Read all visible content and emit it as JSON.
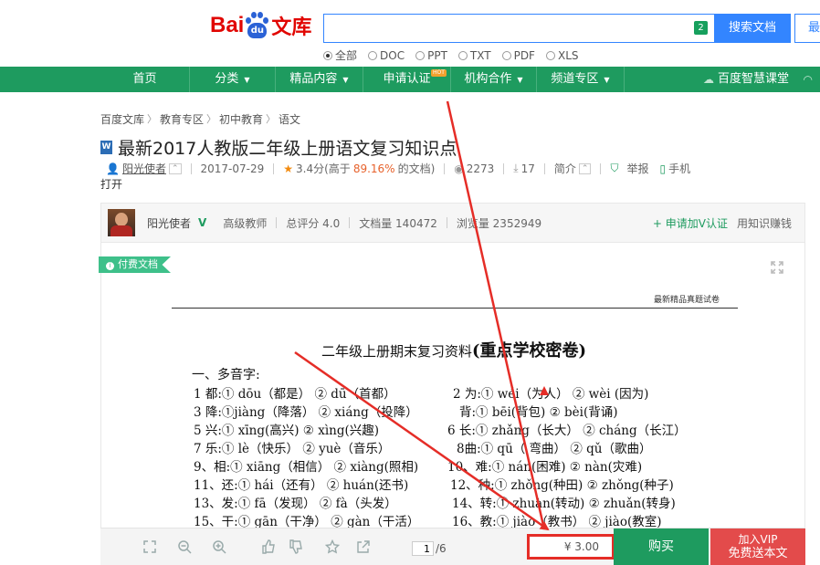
{
  "header": {
    "logo_left": "Bai",
    "logo_paw": "du",
    "logo_right": "文库",
    "search_value": "",
    "search_badge": "2",
    "search_button": "搜索文档",
    "search_button2": "最",
    "filetypes": [
      "全部",
      "DOC",
      "PPT",
      "TXT",
      "PDF",
      "XLS"
    ]
  },
  "nav": {
    "items": [
      "首页",
      "分类",
      "精品内容",
      "申请认证",
      "机构合作",
      "频道专区"
    ],
    "hot": "HOT",
    "right": "百度智慧课堂"
  },
  "breadcrumb": [
    "百度文库",
    "教育专区",
    "初中教育",
    "语文"
  ],
  "doc": {
    "title": "最新2017人教版二年级上册语文复习知识点",
    "author": "阳光使者",
    "date": "2017-07-29",
    "rating": "3.4分(高于",
    "rating_pct": "89.16%",
    "rating_tail": "的文档)",
    "views": "2273",
    "downloads": "17",
    "summary": "简介",
    "report": "举报",
    "mobile": "手机",
    "open": "打开"
  },
  "author_bar": {
    "name": "阳光使者",
    "v": "V",
    "level": "高级教师",
    "score": "总评分 4.0",
    "docs": "文档量 140472",
    "browse": "浏览量 2352949",
    "apply": "+ 申请加V认证",
    "earn": "用知识赚钱"
  },
  "paid_tag": "付费文档",
  "paper": {
    "header": "最新精品真题试卷",
    "title": "二年级上册期末复习资料",
    "title_bold": "(重点学校密卷)",
    "section": "一、多音字:",
    "lines": [
      {
        "a": "1 都:①  dōu（都是） ②  dū（首都）",
        "b": "2 为:①  wéi（为人）    ②  wèi (因为)"
      },
      {
        "a": "3 降:①jiàng（降落）   ②  xiáng（投降）",
        "b": "背:①  bēi(背包)       ②  bèi(背诵)"
      },
      {
        "a": "5 兴:①  xīng(高兴)     ②  xìng(兴趣)",
        "b": "6 长:①  zhǎng（长大）  ②  cháng（长江）"
      },
      {
        "a": "7 乐:①  lè（快乐）      ②  yuè（音乐）",
        "b": "8曲:①  qū（ 弯曲）       ②  qǔ（歌曲）"
      },
      {
        "a": "9、相:①  xiāng（相信）    ②  xiàng(照相)",
        "b": "10、难:①  nán(困难)    ②  nàn(灾难)"
      },
      {
        "a": "11、还:①  hái（还有）    ②  huán(还书)",
        "b": "12、种:①  zhǒng(种田)    ②  zhǒng(种子)"
      },
      {
        "a": "13、发:①  fā（发现）     ②  fà（头发）",
        "b": "14、转:①  zhuàn(转动)    ②  zhuǎn(转身)"
      },
      {
        "a": "15、干:①  gān（干净）    ②  gàn（干活）",
        "b": "16、教:①  jiào（教书）   ②  jiào(教室)"
      }
    ]
  },
  "toolbar": {
    "page_current": "1",
    "page_total": "/6",
    "price": "¥ 3.00",
    "buy": "购买",
    "vip_line1": "加入VIP",
    "vip_line2": "免费送本文"
  },
  "colors": {
    "brand_green": "#1e9b5f",
    "baidu_red": "#e10602",
    "baidu_blue": "#2b62d6",
    "search_blue": "#3385ff",
    "annotation_red": "#e52d27",
    "vip_red": "#e34b4b"
  }
}
